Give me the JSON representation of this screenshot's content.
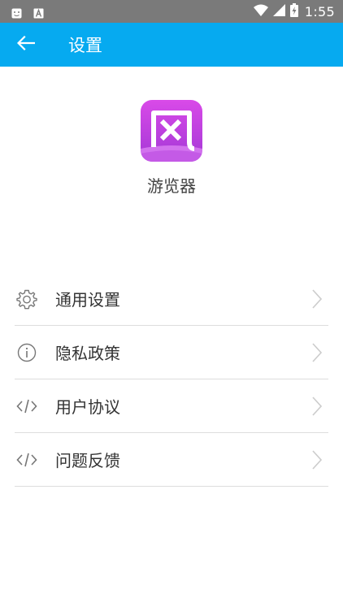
{
  "status_bar": {
    "time": "1:55",
    "left_icons": [
      "notification-icon",
      "text-a-icon"
    ],
    "right_icons": [
      "wifi-icon",
      "signal-icon",
      "battery-charging-icon"
    ]
  },
  "app_bar": {
    "title": "设置",
    "back_icon": "arrow-left-icon",
    "color": "#06aaf0"
  },
  "app_info": {
    "logo_char": "风",
    "name": "游览器",
    "logo_colors": [
      "#d94ae8",
      "#a338d6"
    ]
  },
  "menu": {
    "items": [
      {
        "label": "通用设置",
        "icon": "gear-icon"
      },
      {
        "label": "隐私政策",
        "icon": "info-icon"
      },
      {
        "label": "用户协议",
        "icon": "code-icon"
      },
      {
        "label": "问题反馈",
        "icon": "code-icon"
      }
    ]
  }
}
